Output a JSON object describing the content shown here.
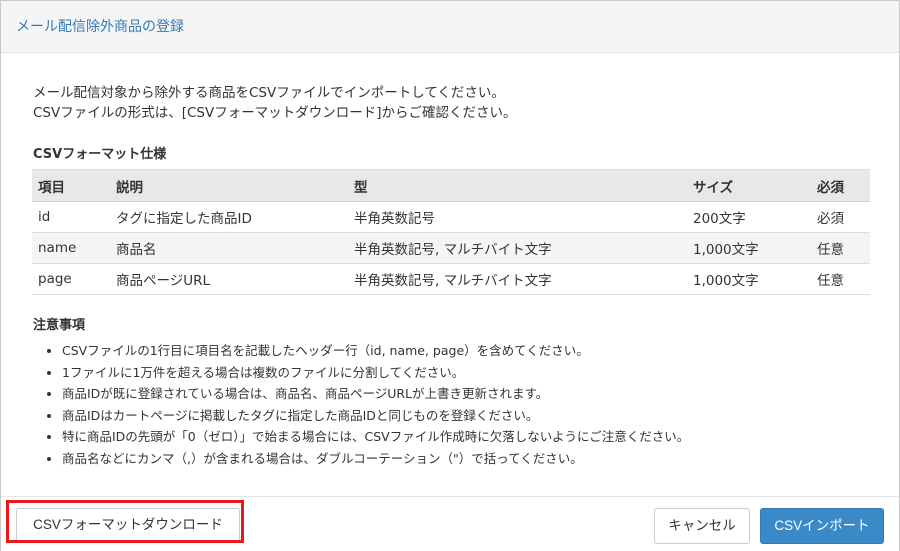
{
  "modal": {
    "title": "メール配信除外商品の登録"
  },
  "intro": {
    "line1": "メール配信対象から除外する商品をCSVファイルでインポートしてください。",
    "line2": "CSVファイルの形式は、[CSVフォーマットダウンロード]からご確認ください。"
  },
  "spec": {
    "heading": "CSVフォーマット仕様",
    "columns": [
      "項目",
      "説明",
      "型",
      "サイズ",
      "必須"
    ],
    "rows": [
      [
        "id",
        "タグに指定した商品ID",
        "半角英数記号",
        "200文字",
        "必須"
      ],
      [
        "name",
        "商品名",
        "半角英数記号, マルチバイト文字",
        "1,000文字",
        "任意"
      ],
      [
        "page",
        "商品ページURL",
        "半角英数記号, マルチバイト文字",
        "1,000文字",
        "任意"
      ]
    ]
  },
  "notes": {
    "heading": "注意事項",
    "items": [
      "CSVファイルの1行目に項目名を記載したヘッダー行（id, name, page）を含めてください。",
      "1ファイルに1万件を超える場合は複数のファイルに分割してください。",
      "商品IDが既に登録されている場合は、商品名、商品ページURLが上書き更新されます。",
      "商品IDはカートページに掲載したタグに指定した商品IDと同じものを登録ください。",
      "特に商品IDの先頭が「0（ゼロ）」で始まる場合には、CSVファイル作成時に欠落しないようにご注意ください。",
      "商品名などにカンマ（,）が含まれる場合は、ダブルコーテーション（\"）で括ってください。"
    ]
  },
  "footer": {
    "download_label": "CSVフォーマットダウンロード",
    "cancel_label": "キャンセル",
    "import_label": "CSVインポート"
  },
  "colors": {
    "title": "#337ab7",
    "primary": "#3b8ac8",
    "highlight": "#e8191c"
  }
}
